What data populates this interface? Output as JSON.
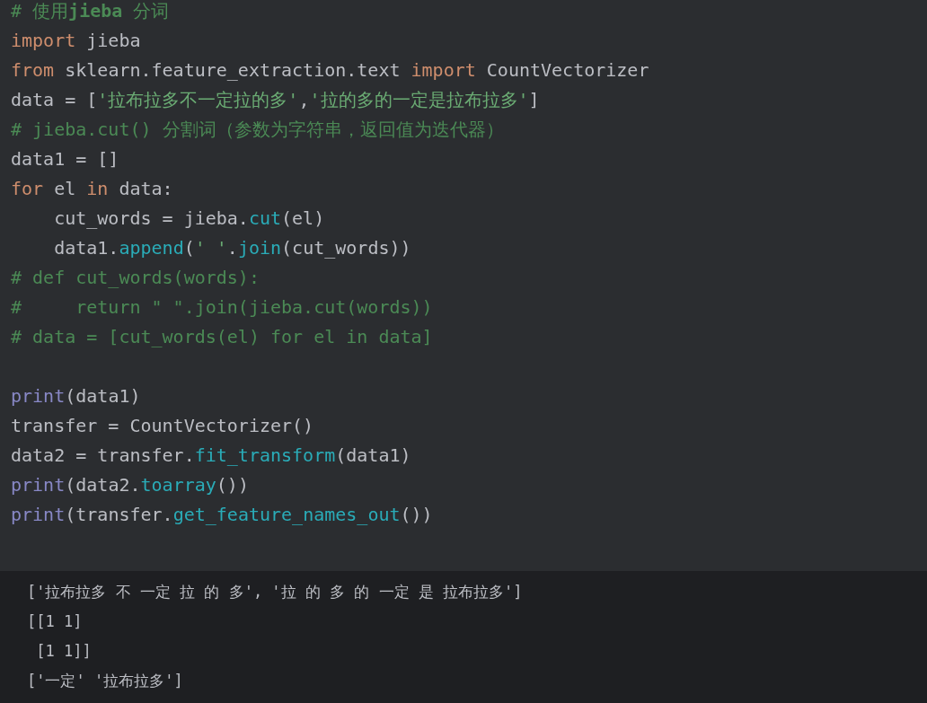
{
  "editor": {
    "lines": [
      {
        "tokens": [
          {
            "kind": "comment",
            "text": "# 使用"
          },
          {
            "kind": "comment_bold",
            "text": "jieba"
          },
          {
            "kind": "comment",
            "text": " 分词"
          }
        ]
      },
      {
        "tokens": [
          {
            "kind": "keyword",
            "text": "import"
          },
          {
            "kind": "plain",
            "text": " jieba"
          }
        ]
      },
      {
        "tokens": [
          {
            "kind": "keyword",
            "text": "from"
          },
          {
            "kind": "plain",
            "text": " sklearn.feature_extraction.text "
          },
          {
            "kind": "keyword",
            "text": "import"
          },
          {
            "kind": "plain",
            "text": " CountVectorizer"
          }
        ]
      },
      {
        "tokens": [
          {
            "kind": "plain",
            "text": "data = ["
          },
          {
            "kind": "string",
            "text": "'拉布拉多不一定拉的多'"
          },
          {
            "kind": "plain",
            "text": ","
          },
          {
            "kind": "string",
            "text": "'拉的多的一定是拉布拉多'"
          },
          {
            "kind": "plain",
            "text": "]"
          }
        ]
      },
      {
        "tokens": [
          {
            "kind": "comment",
            "text": "# jieba.cut() 分割词（参数为字符串，返回值为迭代器）"
          }
        ]
      },
      {
        "tokens": [
          {
            "kind": "plain",
            "text": "data1 = []"
          }
        ]
      },
      {
        "tokens": [
          {
            "kind": "keyword",
            "text": "for"
          },
          {
            "kind": "plain",
            "text": " el "
          },
          {
            "kind": "keyword",
            "text": "in"
          },
          {
            "kind": "plain",
            "text": " data:"
          }
        ]
      },
      {
        "tokens": [
          {
            "kind": "plain",
            "text": "    cut_words = jieba."
          },
          {
            "kind": "method",
            "text": "cut"
          },
          {
            "kind": "plain",
            "text": "(el)"
          }
        ]
      },
      {
        "tokens": [
          {
            "kind": "plain",
            "text": "    data1."
          },
          {
            "kind": "method",
            "text": "append"
          },
          {
            "kind": "plain",
            "text": "("
          },
          {
            "kind": "string",
            "text": "' '"
          },
          {
            "kind": "plain",
            "text": "."
          },
          {
            "kind": "method",
            "text": "join"
          },
          {
            "kind": "plain",
            "text": "(cut_words))"
          }
        ]
      },
      {
        "tokens": [
          {
            "kind": "comment",
            "text": "# def cut_words(words):"
          }
        ]
      },
      {
        "tokens": [
          {
            "kind": "comment",
            "text": "#     return \" \".join(jieba.cut(words))"
          }
        ]
      },
      {
        "tokens": [
          {
            "kind": "comment",
            "text": "# data = [cut_words(el) for el in data]"
          }
        ]
      },
      {
        "gap_before": true,
        "tokens": [
          {
            "kind": "builtin",
            "text": "print"
          },
          {
            "kind": "plain",
            "text": "(data1)"
          }
        ]
      },
      {
        "tokens": [
          {
            "kind": "plain",
            "text": "transfer = CountVectorizer()"
          }
        ]
      },
      {
        "tokens": [
          {
            "kind": "plain",
            "text": "data2 = transfer."
          },
          {
            "kind": "method",
            "text": "fit_transform"
          },
          {
            "kind": "plain",
            "text": "(data1)"
          }
        ]
      },
      {
        "tokens": [
          {
            "kind": "builtin",
            "text": "print"
          },
          {
            "kind": "plain",
            "text": "(data2."
          },
          {
            "kind": "method",
            "text": "toarray"
          },
          {
            "kind": "plain",
            "text": "())"
          }
        ]
      },
      {
        "tokens": [
          {
            "kind": "builtin",
            "text": "print"
          },
          {
            "kind": "plain",
            "text": "(transfer."
          },
          {
            "kind": "method",
            "text": "get_feature_names_out"
          },
          {
            "kind": "plain",
            "text": "())"
          }
        ]
      }
    ]
  },
  "output": {
    "lines": [
      "['拉布拉多 不 一定 拉 的 多', '拉 的 多 的 一定 是 拉布拉多']",
      "[[1 1]",
      " [1 1]]",
      "['一定' '拉布拉多']"
    ]
  }
}
